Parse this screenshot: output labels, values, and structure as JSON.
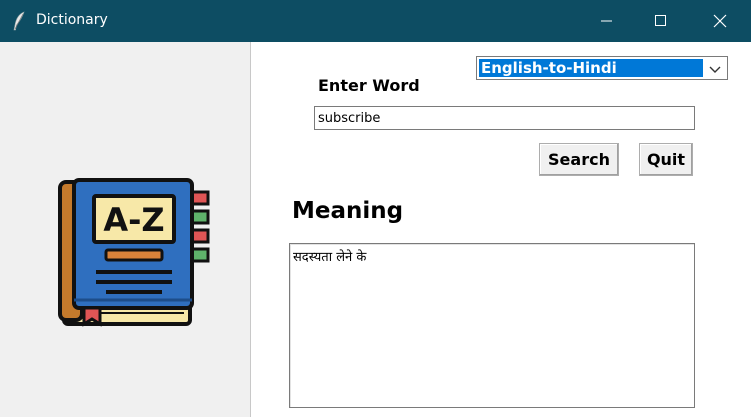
{
  "window": {
    "title": "Dictionary",
    "titlebar_color": "#0d4d63",
    "app_icon": "feather-icon"
  },
  "sidebar": {
    "image": "a-z-book-icon",
    "book_text": "A-Z"
  },
  "language": {
    "selected": "English-to-Hindi"
  },
  "form": {
    "label": "Enter Word",
    "word_value": "subscribe",
    "search_label": "Search",
    "quit_label": "Quit"
  },
  "result": {
    "heading": "Meaning",
    "text": "सदस्यता लेने के"
  }
}
